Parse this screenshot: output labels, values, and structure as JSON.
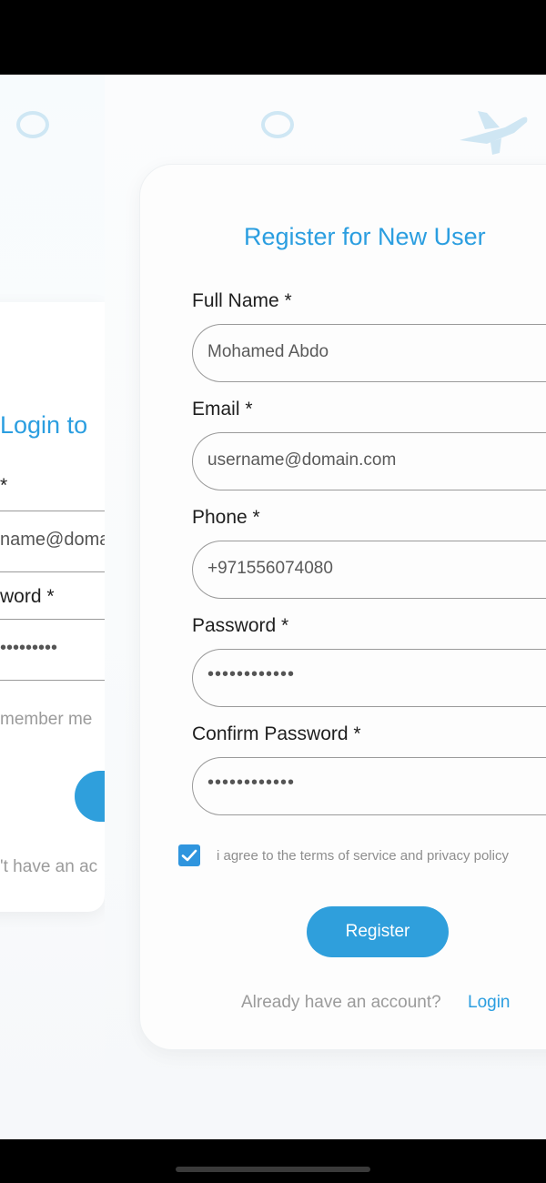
{
  "colors": {
    "accent": "#2b9ee0",
    "button": "#2f9fdc",
    "checkbox": "#2f95de"
  },
  "background_login": {
    "title": "Login to",
    "email_label": "*",
    "email_value": "name@doma",
    "password_label": "word *",
    "password_dots": "•••••••••",
    "remember_label": "member me",
    "signup_prompt": "'t have an ac"
  },
  "register": {
    "title": "Register for New User",
    "fields": [
      {
        "label": "Full Name *",
        "value": "Mohamed Abdo"
      },
      {
        "label": "Email *",
        "value": "username@domain.com"
      },
      {
        "label": "Phone *",
        "value": "+971556074080"
      },
      {
        "label": "Password *",
        "value": "••••••••••••"
      },
      {
        "label": "Confirm Password *",
        "value": "••••••••••••"
      }
    ],
    "agree_checked": true,
    "agree_text": "i agree to the terms of service and privacy policy",
    "register_button": "Register",
    "already_text": "Already have an account?",
    "login_link": "Login"
  },
  "icons": [
    "airplane-icon",
    "checkmark-icon"
  ]
}
